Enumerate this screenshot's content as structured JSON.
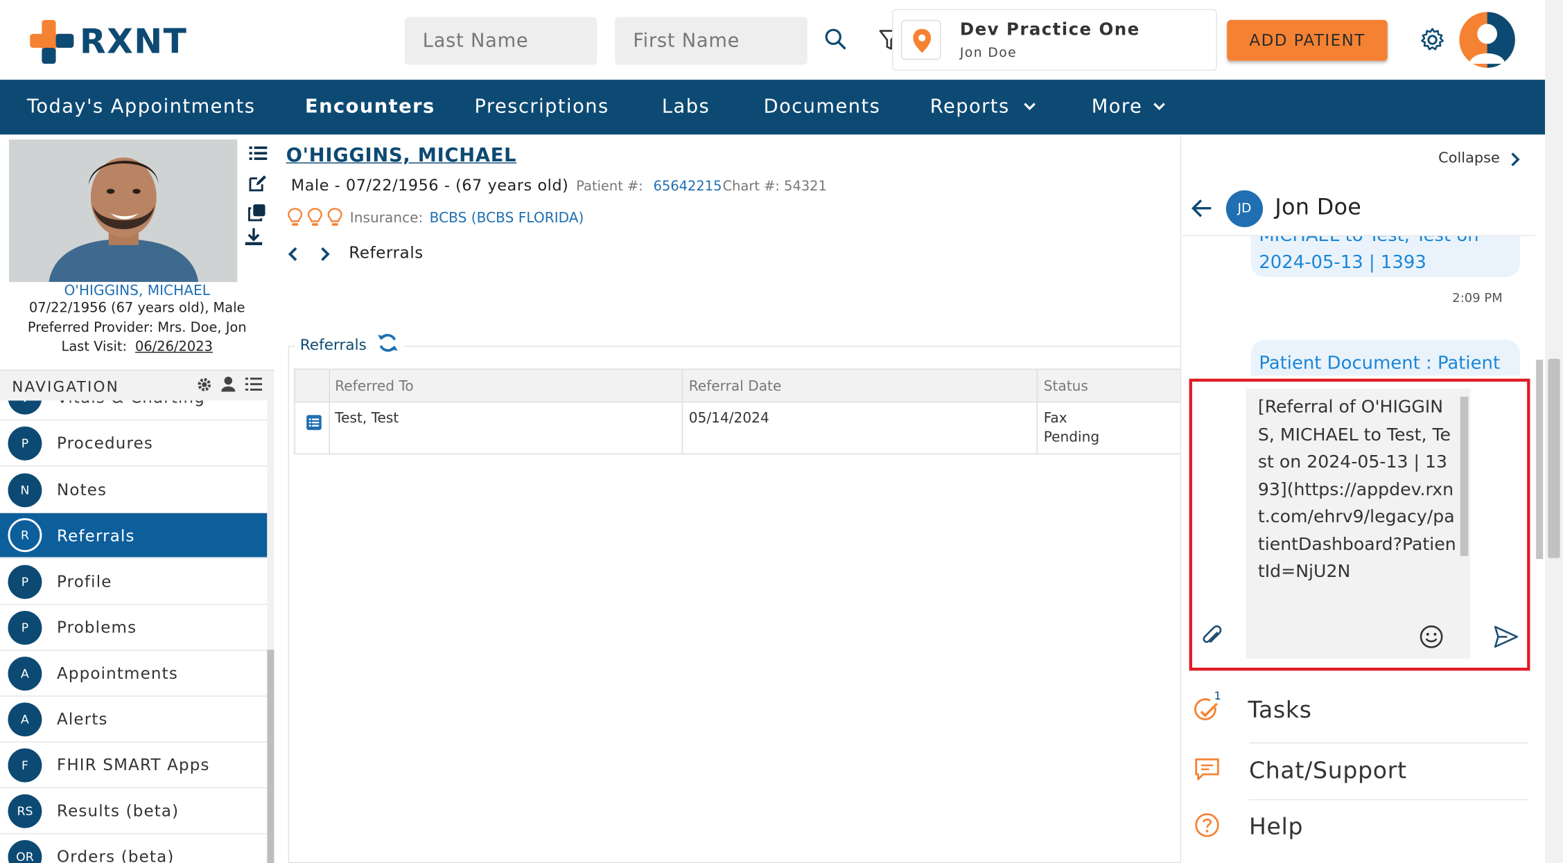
{
  "header": {
    "logo_text": "RXNT",
    "last_name_placeholder": "Last Name",
    "first_name_placeholder": "First Name",
    "practice_name": "Dev Practice One",
    "practice_user": "Jon Doe",
    "add_patient_label": "ADD PATIENT"
  },
  "nav": {
    "items": [
      {
        "label": "Today's Appointments"
      },
      {
        "label": "Encounters"
      },
      {
        "label": "Prescriptions"
      },
      {
        "label": "Labs"
      },
      {
        "label": "Documents"
      },
      {
        "label": "Reports"
      },
      {
        "label": "More"
      }
    ],
    "active": "Encounters"
  },
  "patient_card": {
    "name": "O'HIGGINS, MICHAEL",
    "dob_line": "07/22/1956 (67 years old), Male",
    "provider_line": "Preferred Provider: Mrs. Doe, Jon",
    "last_visit_label": "Last Visit:",
    "last_visit_value": "06/26/2023"
  },
  "left_nav": {
    "title": "NAVIGATION",
    "partial_item": "Vitals & Charting",
    "items": [
      {
        "badge": "P",
        "label": "Procedures"
      },
      {
        "badge": "N",
        "label": "Notes"
      },
      {
        "badge": "R",
        "label": "Referrals",
        "active": true
      },
      {
        "badge": "P",
        "label": "Profile"
      },
      {
        "badge": "P",
        "label": "Problems"
      },
      {
        "badge": "A",
        "label": "Appointments"
      },
      {
        "badge": "A",
        "label": "Alerts"
      },
      {
        "badge": "F",
        "label": "FHIR SMART Apps"
      },
      {
        "badge": "RS",
        "label": "Results (beta)"
      },
      {
        "badge": "OR",
        "label": "Orders (beta)"
      }
    ]
  },
  "patient_header": {
    "name": "O'HIGGINS, MICHAEL",
    "demographics": "Male - 07/22/1956 - (67 years old)",
    "patient_num_label": "Patient #:",
    "patient_num": "65642215",
    "chart_label": "Chart #: 54321",
    "insurance_label": "Insurance:",
    "insurance_value": "BCBS (BCBS FLORIDA)",
    "breadcrumb": "Referrals"
  },
  "referrals": {
    "panel_title": "Referrals",
    "columns": [
      "Referred To",
      "Referral Date",
      "Status"
    ],
    "rows": [
      {
        "referred_to": "Test, Test",
        "date": "05/14/2024",
        "status_line1": "Fax",
        "status_line2": "Pending"
      }
    ]
  },
  "chat": {
    "collapse_label": "Collapse",
    "contact_initials": "JD",
    "contact_name": "Jon Doe",
    "msg1_line1": "MICHAEL to Test, Test on",
    "msg1_line2": "2024-05-13 | 1393",
    "msg1_time": "2:09 PM",
    "msg2_line1": "Patient Document : Patient",
    "compose_text": "[Referral of O'HIGGINS, MICHAEL to Test, Test on 2024-05-13 | 1393](https://appdev.rxnt.com/ehrv9/legacy/patientDashboard?PatientId=NjU2N"
  },
  "quick_links": {
    "tasks_label": "Tasks",
    "tasks_count": "1",
    "chat_label": "Chat/Support",
    "help_label": "Help"
  },
  "colors": {
    "brand_navy": "#0d4a73",
    "accent_orange": "#f58233",
    "link_blue": "#1f6fb2",
    "highlight_red": "#e01b24"
  }
}
